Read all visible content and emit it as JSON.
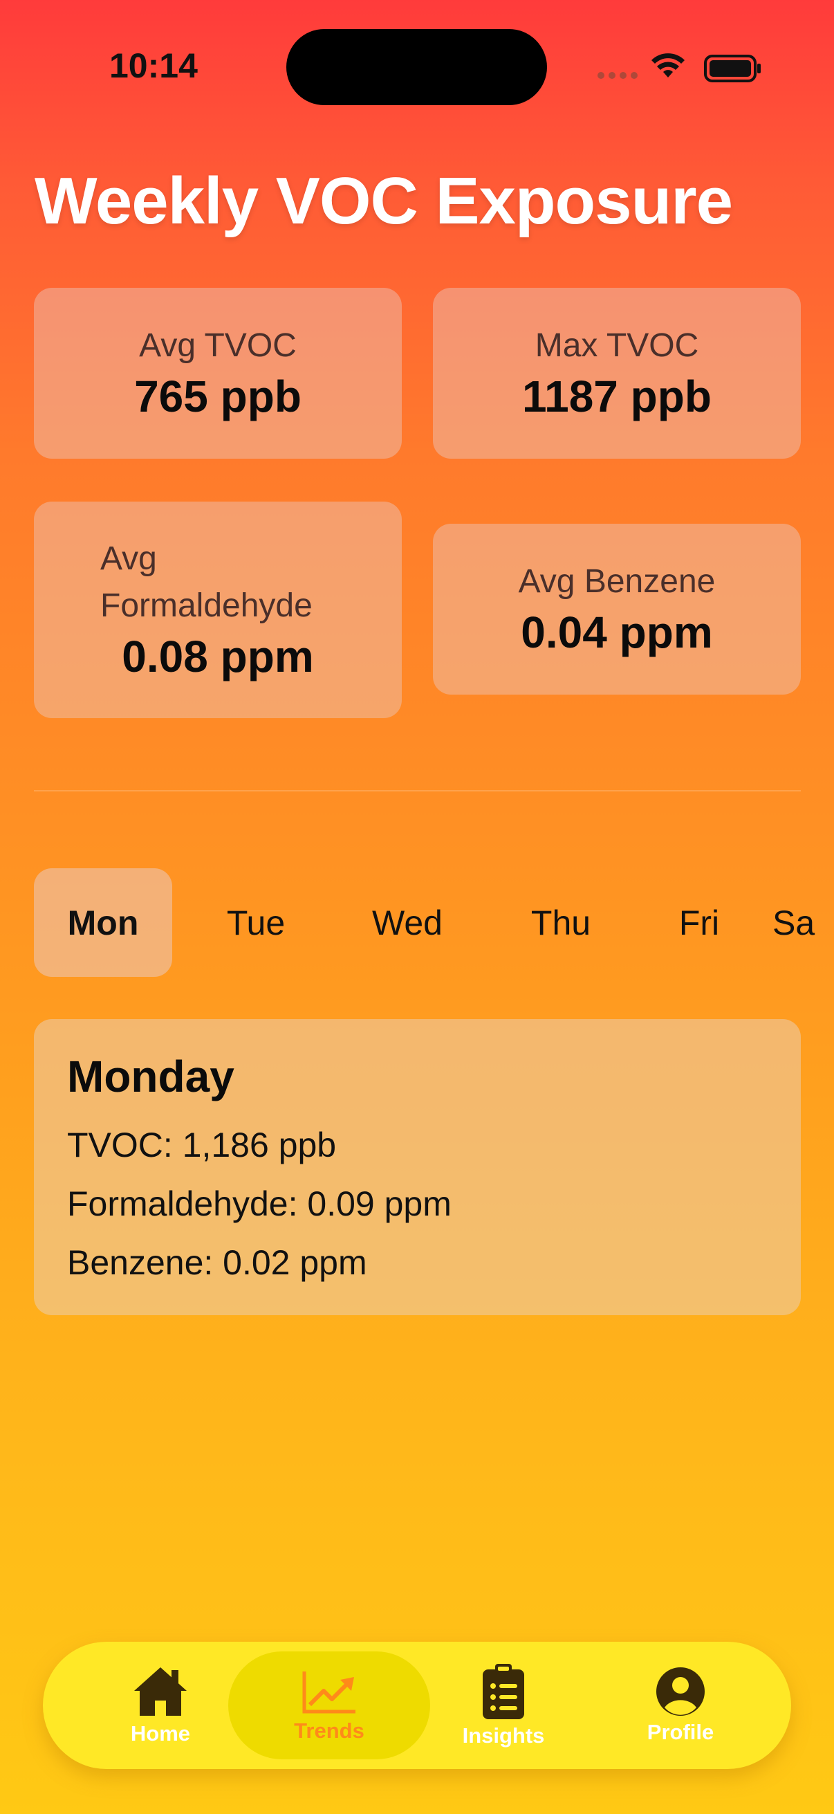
{
  "status_bar": {
    "time": "10:14"
  },
  "header": {
    "title": "Weekly VOC Exposure"
  },
  "stats": [
    {
      "label": "Avg TVOC",
      "value": "765 ppb"
    },
    {
      "label": "Max TVOC",
      "value": "1187 ppb"
    },
    {
      "label": "Avg Formaldehyde",
      "value": "0.08 ppm"
    },
    {
      "label": "Avg Benzene",
      "value": "0.04 ppm"
    }
  ],
  "days": [
    "Mon",
    "Tue",
    "Wed",
    "Thu",
    "Fri",
    "Sa"
  ],
  "selected_day": "Mon",
  "detail": {
    "day_name": "Monday",
    "tvoc": "TVOC: 1,186 ppb",
    "formaldehyde": "Formaldehyde: 0.09 ppm",
    "benzene": "Benzene: 0.02 ppm"
  },
  "tabbar": {
    "items": [
      {
        "label": "Home",
        "icon": "house-icon"
      },
      {
        "label": "Trends",
        "icon": "chart-line-icon"
      },
      {
        "label": "Insights",
        "icon": "clipboard-icon"
      },
      {
        "label": "Profile",
        "icon": "person-circle-icon"
      }
    ],
    "active": "Trends"
  },
  "colors": {
    "accent": "#ff8a1a",
    "tabbar": "#ffe826",
    "icon": "#3a2a08"
  }
}
